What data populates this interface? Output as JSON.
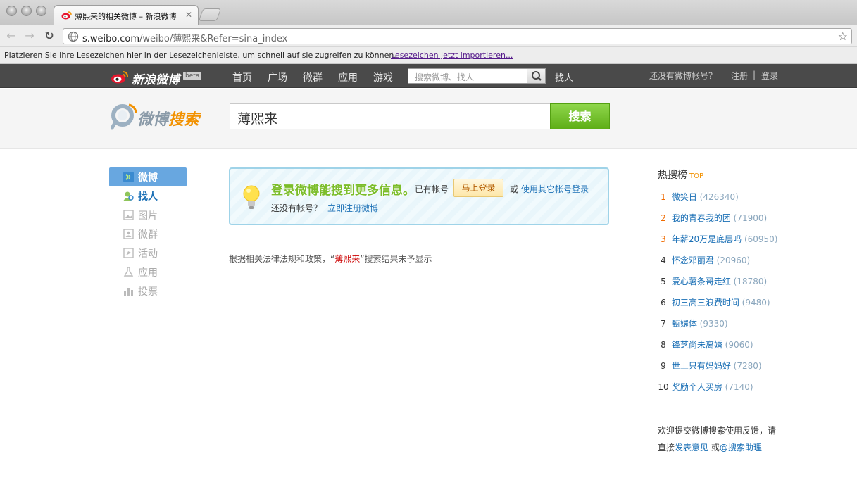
{
  "browser": {
    "tab_title": "薄熙来的相关微博 – 新浪微博",
    "tab_close": "✕",
    "url_host": "s.weibo.com",
    "url_path": "/weibo/薄熙来&Refer=sina_index",
    "bookmarks_message": "Platzieren Sie Ihre Lesezeichen hier in der Lesezeichenleiste, um schnell auf sie zugreifen zu können.",
    "bookmarks_import_link": "Lesezeichen jetzt importieren..."
  },
  "weibo_nav": {
    "logo_text": "新浪微博",
    "beta": "beta",
    "items": [
      "首页",
      "广场",
      "微群",
      "应用",
      "游戏"
    ],
    "search_placeholder": "搜索微博、找人",
    "find_people": "找人",
    "no_account": "还没有微博帐号？",
    "register": "注册",
    "separator": "|",
    "login": "登录"
  },
  "search": {
    "logo_part1": "微博",
    "logo_part2": "搜索",
    "query": "薄熙来",
    "button": "搜索"
  },
  "sidebar": {
    "items": [
      {
        "label": "微博",
        "icon": "weibo-icon"
      },
      {
        "label": "找人",
        "icon": "people-icon"
      },
      {
        "label": "图片",
        "icon": "image-icon"
      },
      {
        "label": "微群",
        "icon": "group-icon"
      },
      {
        "label": "活动",
        "icon": "event-icon"
      },
      {
        "label": "应用",
        "icon": "app-icon"
      },
      {
        "label": "投票",
        "icon": "vote-icon"
      }
    ]
  },
  "notice": {
    "headline": "登录微博能搜到更多信息。",
    "has_account": "已有帐号",
    "login_now": "马上登录",
    "or": "或",
    "other_login": "使用其它帐号登录",
    "no_account": "还没有帐号？",
    "register_now": "立即注册微博"
  },
  "result": {
    "prefix": "根据相关法律法规和政策，“",
    "keyword": "薄熙来",
    "suffix": "”搜索结果未予显示"
  },
  "hot": {
    "title": "热搜榜",
    "top": "TOP",
    "items": [
      {
        "rank": "1",
        "text": "微笑日",
        "count": "(426340)"
      },
      {
        "rank": "2",
        "text": "我的青春我的团",
        "count": "(71900)"
      },
      {
        "rank": "3",
        "text": "年薪20万是底层吗",
        "count": "(60950)"
      },
      {
        "rank": "4",
        "text": "怀念邓丽君",
        "count": "(20960)"
      },
      {
        "rank": "5",
        "text": "爱心薯条哥走红",
        "count": "(18780)"
      },
      {
        "rank": "6",
        "text": "初三高三浪费时间",
        "count": "(9480)"
      },
      {
        "rank": "7",
        "text": "甄嬛体",
        "count": "(9330)"
      },
      {
        "rank": "8",
        "text": "锋芝尚未离婚",
        "count": "(9060)"
      },
      {
        "rank": "9",
        "text": "世上只有妈妈好",
        "count": "(7280)"
      },
      {
        "rank": "10",
        "text": "奖励个人买房",
        "count": "(7140)"
      }
    ],
    "feedback_line1": "欢迎提交微博搜索使用反馈，请",
    "feedback_prefix": "直接",
    "feedback_link1": "发表意见",
    "feedback_or": "或",
    "feedback_link2": "@搜索助理"
  }
}
